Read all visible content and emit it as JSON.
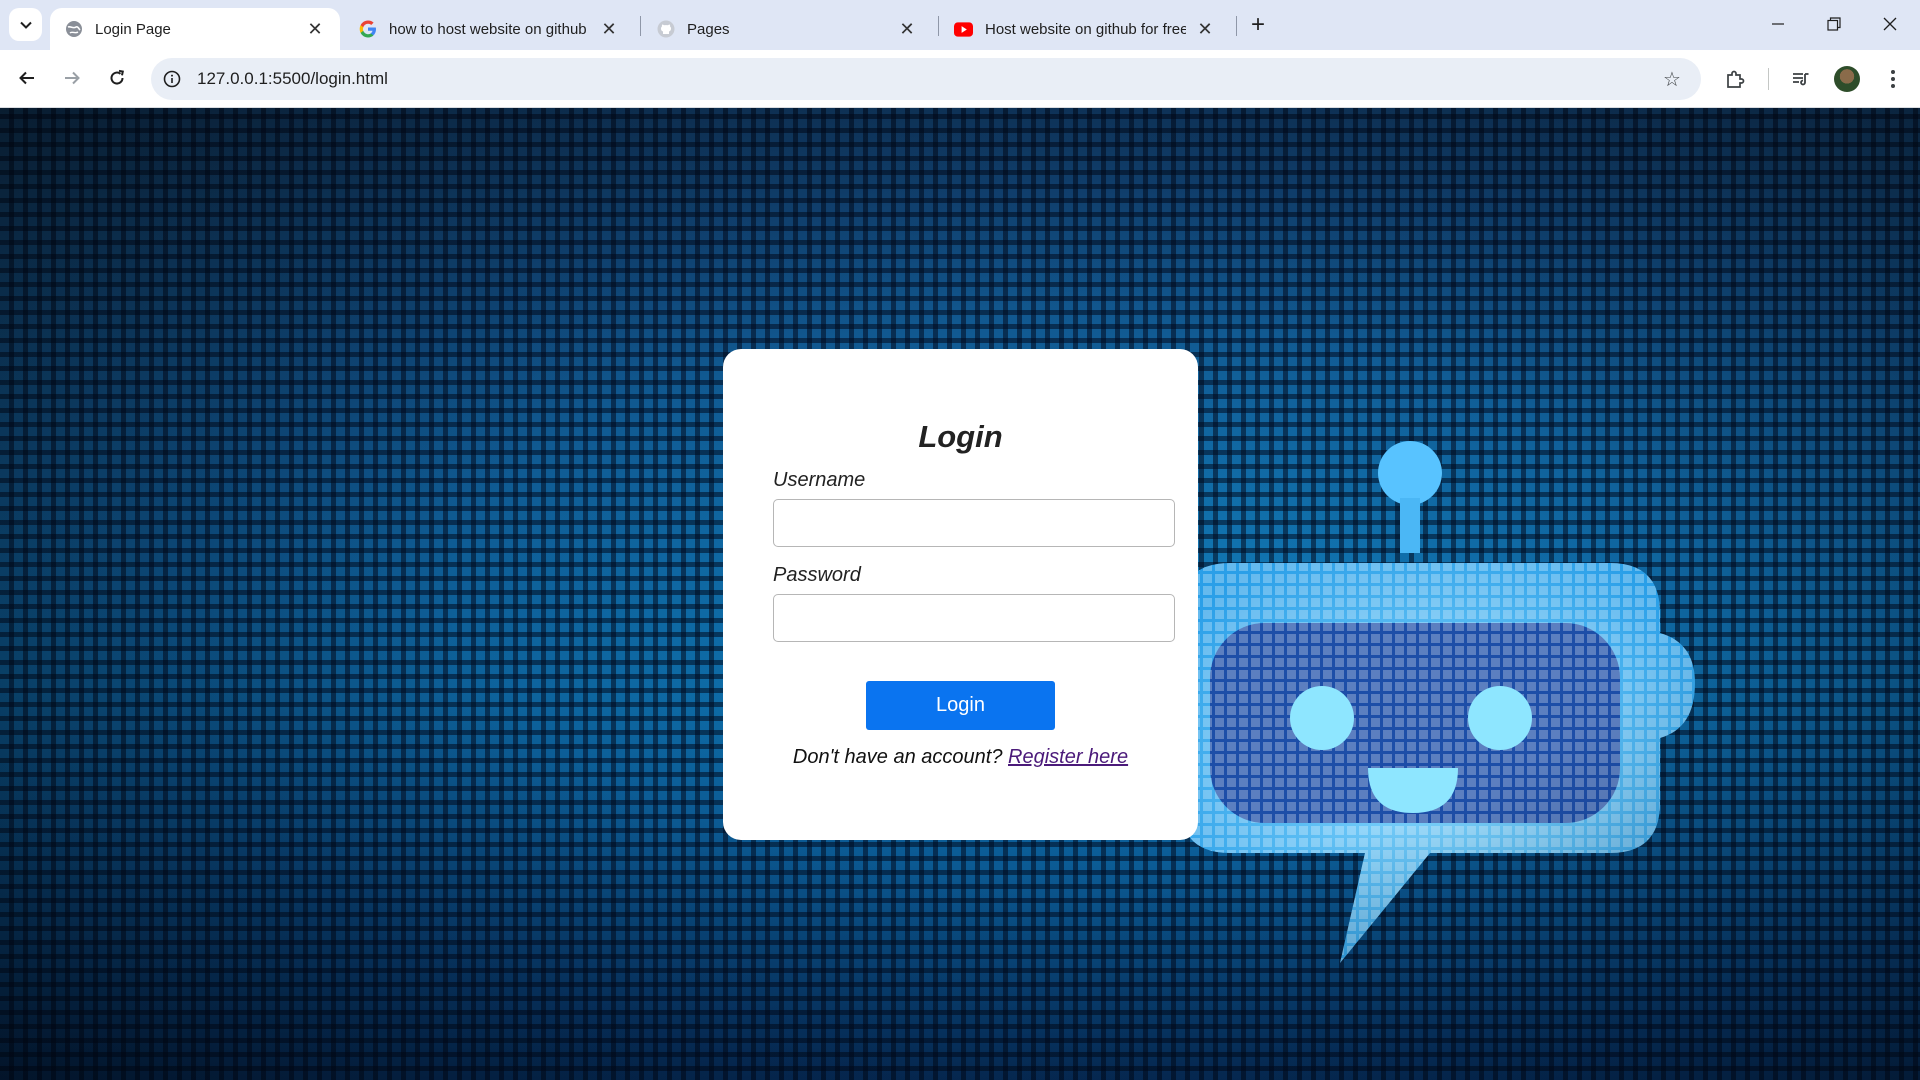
{
  "browser": {
    "tabs": [
      {
        "title": "Login Page",
        "favicon": "globe-icon",
        "active": true
      },
      {
        "title": "how to host website on github",
        "favicon": "google-icon",
        "active": false
      },
      {
        "title": "Pages",
        "favicon": "github-icon",
        "active": false
      },
      {
        "title": "Host website on github for free",
        "favicon": "youtube-icon",
        "active": false
      }
    ],
    "url": "127.0.0.1:5500/login.html"
  },
  "login": {
    "title": "Login",
    "username_label": "Username",
    "username_value": "",
    "password_label": "Password",
    "password_value": "",
    "button_label": "Login",
    "register_prompt": "Don't have an account?",
    "register_link": "Register here"
  },
  "colors": {
    "button": "#0a74f0",
    "link": "#4b1a7a",
    "tabbar": "#dfe6f5"
  }
}
